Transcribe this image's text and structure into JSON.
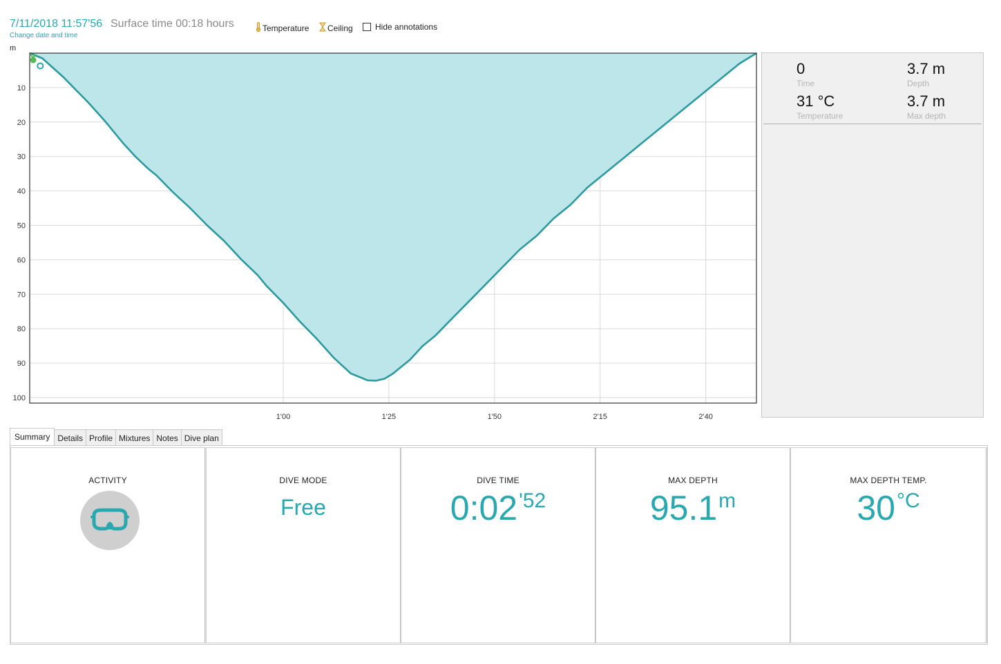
{
  "header": {
    "datetime": "7/11/2018 11:57'56",
    "surface_time": "Surface time 00:18 hours",
    "change_link": "Change date and time",
    "temperature_label": "Temperature",
    "ceiling_label": "Ceiling",
    "hide_annotations_label": "Hide annotations",
    "hide_annotations_checked": false
  },
  "chart_data": {
    "type": "area",
    "title": "",
    "xlabel": "",
    "ylabel": "m",
    "ylim": [
      0,
      102
    ],
    "y_inverted": true,
    "xlim": [
      0,
      172
    ],
    "x_ticks": [
      {
        "value": 60,
        "label": "1'00"
      },
      {
        "value": 85,
        "label": "1'25"
      },
      {
        "value": 110,
        "label": "1'50"
      },
      {
        "value": 135,
        "label": "2'15"
      },
      {
        "value": 160,
        "label": "2'40"
      }
    ],
    "y_ticks": [
      10,
      20,
      30,
      40,
      50,
      60,
      70,
      80,
      90,
      100
    ],
    "grid": true,
    "fill_color": "#bde6ea",
    "line_color": "#2a9a9e",
    "series": [
      {
        "x": [
          0,
          3,
          5,
          8,
          12,
          14,
          18,
          22,
          25,
          28,
          30,
          34,
          38,
          42,
          46,
          50,
          54,
          56,
          60,
          64,
          68,
          72,
          76,
          80,
          82,
          84,
          86,
          88,
          90,
          93,
          96,
          100,
          104,
          108,
          112,
          116,
          120,
          124,
          128,
          132,
          136,
          140,
          144,
          148,
          152,
          156,
          160,
          164,
          168,
          170,
          172
        ],
        "y": [
          0,
          1.5,
          3.7,
          7,
          12,
          14.5,
          20,
          26,
          30,
          33.5,
          35.5,
          40.5,
          45,
          50,
          54.5,
          59.8,
          64.5,
          67.5,
          72.5,
          78,
          83,
          88.5,
          93,
          95,
          95.1,
          94.5,
          93,
          91,
          89,
          85,
          82,
          77,
          72,
          67,
          62,
          57,
          53,
          48,
          44,
          39,
          35,
          31,
          27,
          23,
          19,
          15,
          11,
          7,
          3,
          1.5,
          0
        ]
      }
    ]
  },
  "info_panel": {
    "time_value": "0",
    "time_label": "Time",
    "depth_value": "3.7 m",
    "depth_label": "Depth",
    "temp_value": "31 °C",
    "temp_label": "Temperature",
    "maxdepth_value": "3.7 m",
    "maxdepth_label": "Max depth"
  },
  "tabs": [
    "Summary",
    "Details",
    "Profile",
    "Mixtures",
    "Notes",
    "Dive plan"
  ],
  "summary": {
    "activity_title": "ACTIVITY",
    "activity_icon": "diving-mask-icon",
    "dive_mode_title": "DIVE MODE",
    "dive_mode_value": "Free",
    "dive_time_title": "DIVE TIME",
    "dive_time_main": "0:02",
    "dive_time_sec": "'52",
    "max_depth_title": "MAX DEPTH",
    "max_depth_value": "95.1",
    "max_depth_unit": "m",
    "max_depth_temp_title": "MAX DEPTH TEMP.",
    "max_depth_temp_value": "30",
    "max_depth_temp_unit": "°C"
  },
  "colors": {
    "accent": "#2aa8b0",
    "panel_bg": "#f0f0f0",
    "marker_green": "#58b858"
  }
}
